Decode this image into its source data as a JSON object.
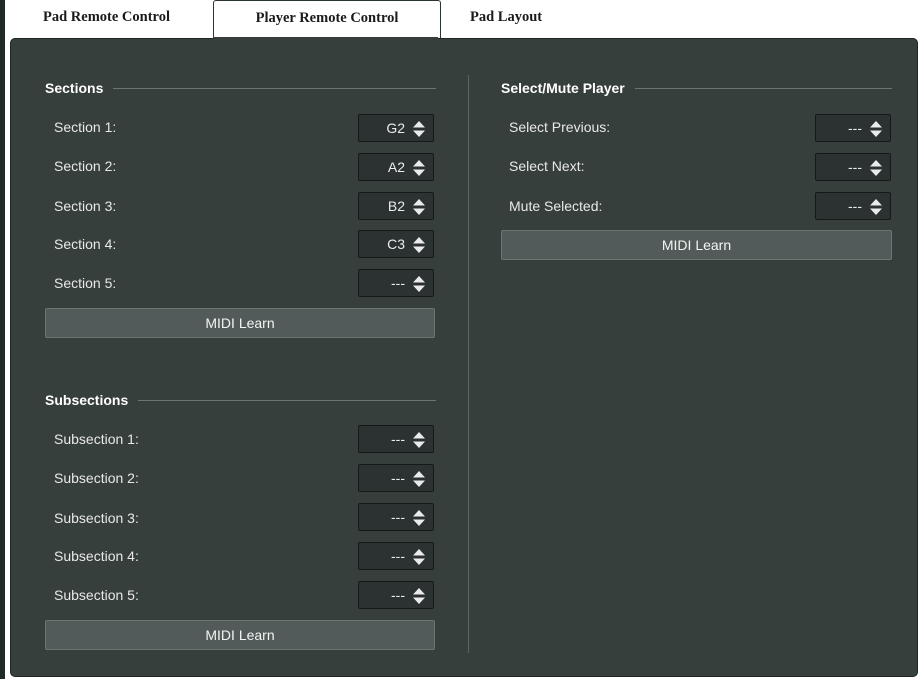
{
  "tabs": [
    {
      "label": "Pad Remote Control",
      "active": false
    },
    {
      "label": "Player Remote Control",
      "active": true
    },
    {
      "label": "Pad Layout",
      "active": false
    }
  ],
  "sections": {
    "title": "Sections",
    "rows": [
      {
        "label": "Section 1:",
        "value": "G2"
      },
      {
        "label": "Section 2:",
        "value": "A2"
      },
      {
        "label": "Section 3:",
        "value": "B2"
      },
      {
        "label": "Section 4:",
        "value": "C3"
      },
      {
        "label": "Section 5:",
        "value": "---"
      }
    ],
    "midi_learn": "MIDI Learn"
  },
  "subsections": {
    "title": "Subsections",
    "rows": [
      {
        "label": "Subsection 1:",
        "value": "---"
      },
      {
        "label": "Subsection 2:",
        "value": "---"
      },
      {
        "label": "Subsection 3:",
        "value": "---"
      },
      {
        "label": "Subsection 4:",
        "value": "---"
      },
      {
        "label": "Subsection 5:",
        "value": "---"
      }
    ],
    "midi_learn": "MIDI Learn"
  },
  "select_mute": {
    "title": "Select/Mute Player",
    "rows": [
      {
        "label": "Select Previous:",
        "value": "---"
      },
      {
        "label": "Select Next:",
        "value": "---"
      },
      {
        "label": "Mute Selected:",
        "value": "---"
      }
    ],
    "midi_learn": "MIDI Learn"
  },
  "colors": {
    "panel": "#373f3d",
    "spinbox": "#2b3231",
    "button": "#525b59"
  },
  "icons": {
    "spin_arrows": "up-down-arrows-icon"
  }
}
